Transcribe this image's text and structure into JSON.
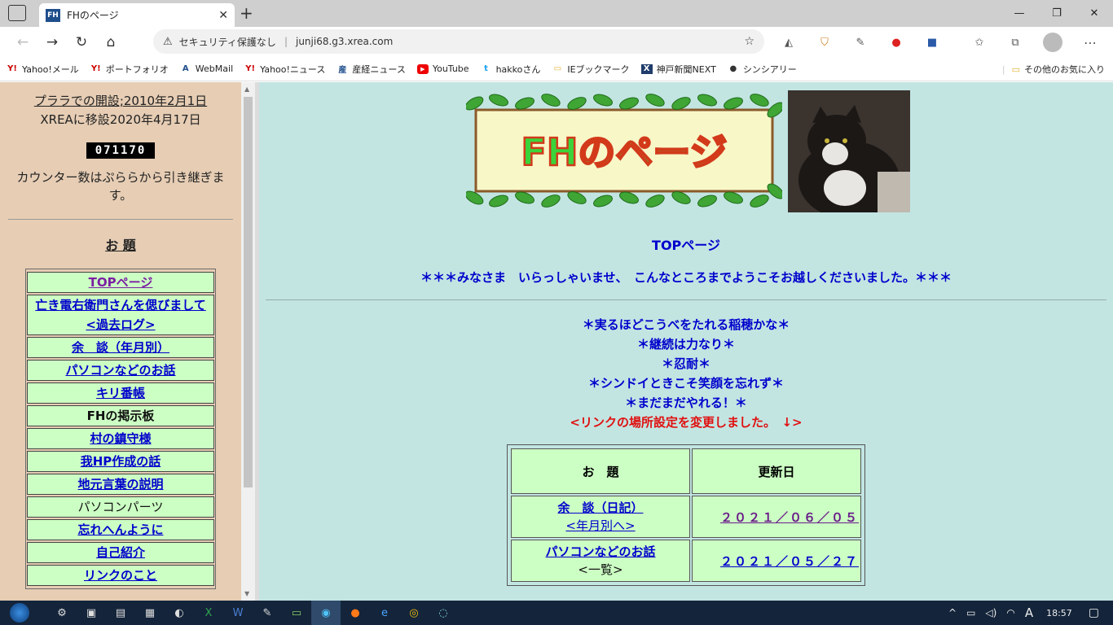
{
  "browser": {
    "tab_title": "FHのページ",
    "tab_favicon": "FH",
    "address": "junji68.g3.xrea.com",
    "security_label": "セキュリティ保護なし"
  },
  "bookmarks": [
    {
      "label": "Yahoo!メール",
      "icon": "Y!"
    },
    {
      "label": "ポートフォリオ",
      "icon": "Y!"
    },
    {
      "label": "WebMail",
      "icon": "A"
    },
    {
      "label": "Yahoo!ニュース",
      "icon": "Y!"
    },
    {
      "label": "産経ニュース",
      "icon": "産"
    },
    {
      "label": "YouTube",
      "icon": "▶"
    },
    {
      "label": "hakkoさん",
      "icon": "t"
    },
    {
      "label": "IEブックマーク",
      "icon": "▭"
    },
    {
      "label": "神戸新聞NEXT",
      "icon": "X"
    },
    {
      "label": "シンシアリー",
      "icon": "●"
    }
  ],
  "bookmarks_other": "その他のお気に入り",
  "sidebar": {
    "opened": "プララでの開設;2010年2月1日",
    "moved": "XREAに移設2020年4月17日",
    "counter": "071170",
    "counter_note": "カウンター数はぷららから引き継ぎます。",
    "heading": "お 題",
    "items": [
      "TOPページ",
      "亡き電右衛門さんを偲びまして<過去ログ>",
      "余　談（年月別）",
      "パソコンなどのお話",
      "キリ番帳",
      "FHの掲示板",
      "村の鎮守様",
      "我HP作成の話",
      "地元言葉の説明",
      "パソコンパーツ",
      "忘れへんように",
      "自己紹介",
      "リンクのこと"
    ]
  },
  "main": {
    "logo_text": "FHのページ",
    "page_title": "TOPページ",
    "welcome": "＊＊＊みなさま　いらっしゃいませ、　こんなところまでようこそお越しくださいました。＊＊＊",
    "mottos": [
      "＊実るほどこうべをたれる稲穂かな＊",
      "＊継続は力なり＊",
      "＊忍耐＊",
      "＊シンドイときこそ笑顔を忘れず＊",
      "＊まだまだやれる！＊"
    ],
    "notice": "<リンクの場所設定を変更しました。　↓>",
    "table": {
      "headers": [
        "お　題",
        "更新日"
      ],
      "rows": [
        {
          "title": "余　談（日記）",
          "sub": "<年月別へ>",
          "date": "２０２１／０６／０５"
        },
        {
          "title": "パソコンなどのお話",
          "sub": "<一覧>",
          "date": "２０２１／０５／２７"
        }
      ]
    }
  },
  "taskbar": {
    "time": "18:57",
    "ime": "A"
  }
}
